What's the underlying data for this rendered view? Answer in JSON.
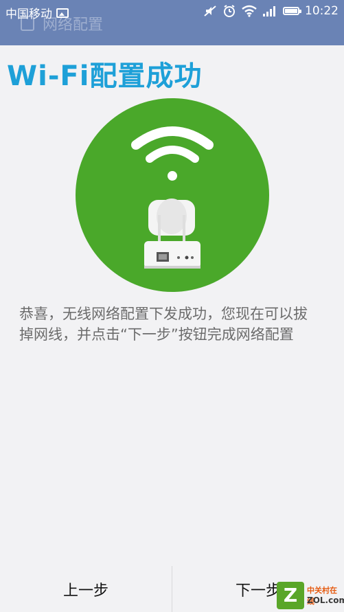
{
  "status_bar": {
    "carrier": "中国移动",
    "time": "10:22",
    "icons": [
      "image-icon",
      "mute-icon",
      "alarm-icon",
      "wifi-icon",
      "signal-icon",
      "battery-icon"
    ]
  },
  "app_bar": {
    "title": "网络配置"
  },
  "page": {
    "title": "Wi-Fi配置成功",
    "message": "恭喜，无线网络配置下发成功，您现在可以拔掉网线，并点击“下一步”按钮完成网络配置"
  },
  "buttons": {
    "prev": "上一步",
    "next": "下一步"
  },
  "watermark": {
    "line1": "中关村在线",
    "line2": "ZOL.com.cn"
  },
  "colors": {
    "status_bar": "#6a83b5",
    "title": "#1ea0d8",
    "circle": "#4aa82a",
    "background": "#f2f2f4"
  }
}
